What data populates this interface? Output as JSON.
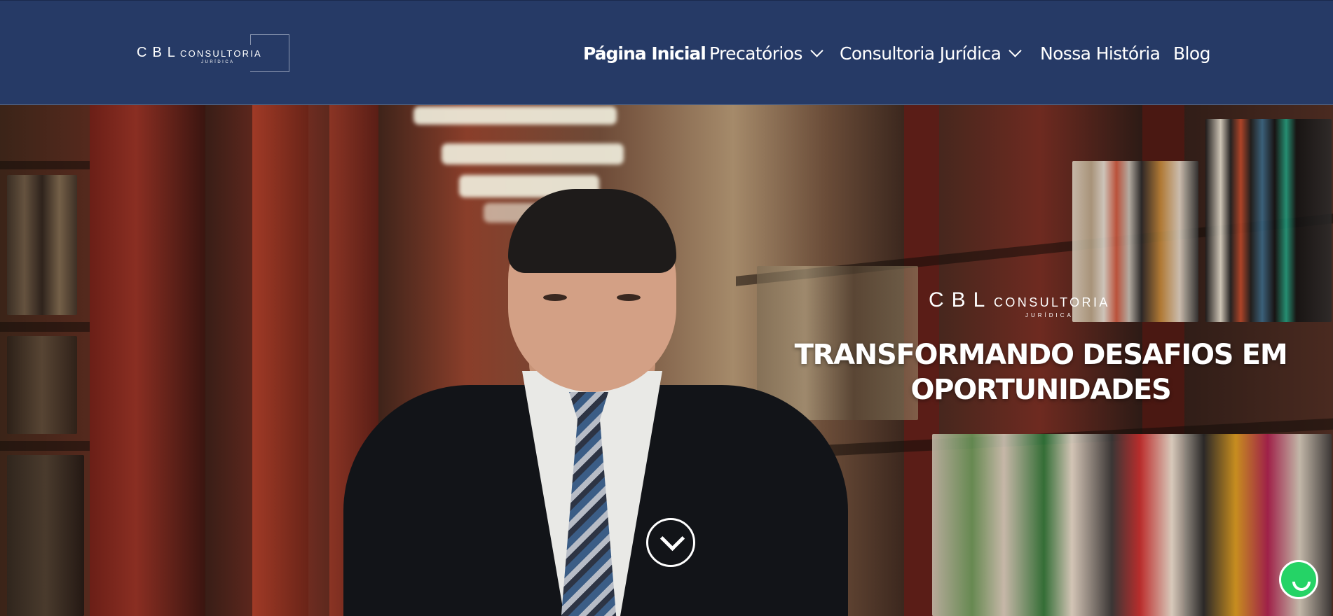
{
  "header": {
    "logo": {
      "cbl": "CBL",
      "consultoria": "CONSULTORIA",
      "juridica": "JURÍDICA"
    },
    "nav": [
      {
        "label": "Página Inicial",
        "active": true,
        "has_dropdown": false
      },
      {
        "label": "Precatórios",
        "active": false,
        "has_dropdown": true
      },
      {
        "label": "Consultoria Jurídica",
        "active": false,
        "has_dropdown": true
      },
      {
        "label": "Nossa História",
        "active": false,
        "has_dropdown": false
      },
      {
        "label": "Blog",
        "active": false,
        "has_dropdown": false
      }
    ]
  },
  "hero": {
    "logo": {
      "cbl": "CBL",
      "consultoria": "CONSULTORIA",
      "juridica": "JURÍDICA"
    },
    "title_line1": "TRANSFORMANDO DESAFIOS EM",
    "title_line2": "OPORTUNIDADES",
    "scroll_icon": "chevron-down-icon"
  },
  "floating": {
    "whatsapp_icon": "whatsapp-icon"
  },
  "colors": {
    "header_bg": "#263a66",
    "whatsapp": "#25d366"
  }
}
